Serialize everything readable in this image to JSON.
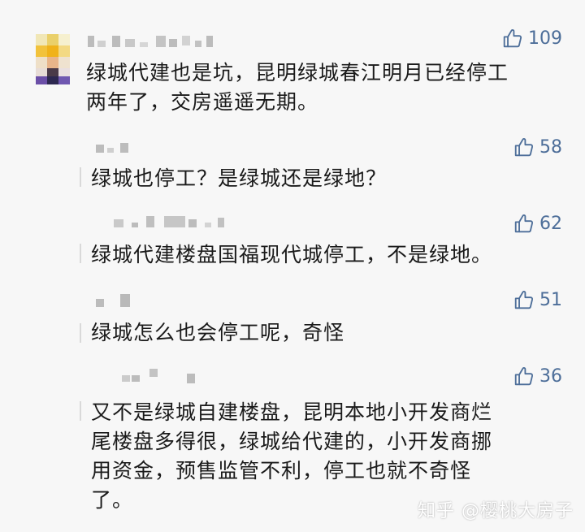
{
  "colors": {
    "background": "#f7f7f7",
    "text": "#1a1a1a",
    "like_accent": "#4d6e99",
    "blurred_username": "#bcbcbc"
  },
  "comment": {
    "likes": "109",
    "lines": [
      "绿城代建也是坑，昆明绿城春江明月已经停工",
      "两年了，交房遥遥无期。"
    ]
  },
  "replies": [
    {
      "likes": "58",
      "lines": [
        "绿城也停工？是绿城还是绿地？"
      ]
    },
    {
      "likes": "62",
      "lines": [
        "绿城代建楼盘国福现代城停工，不是绿地。"
      ]
    },
    {
      "likes": "51",
      "lines": [
        "绿城怎么也会停工呢，奇怪"
      ]
    },
    {
      "likes": "36",
      "lines": [
        "又不是绿城自建楼盘，昆明本地小开发商烂",
        "尾楼盘多得很，绿城给代建的，小开发商挪",
        "用资金，预售监管不利，停工也就不奇怪",
        "了。"
      ]
    }
  ],
  "icons": {
    "like": "thumbs-up-icon"
  },
  "watermark": "知乎 @樱桃大房子"
}
